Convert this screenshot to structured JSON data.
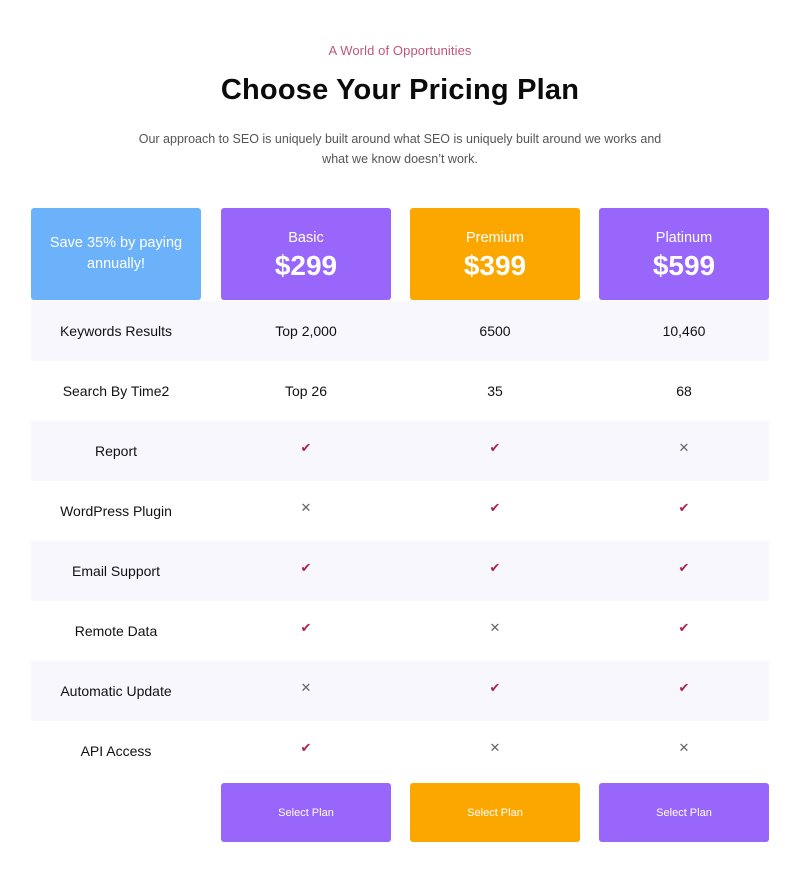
{
  "header": {
    "eyebrow": "A World of Opportunities",
    "title": "Choose Your Pricing Plan",
    "subtitle": "Our approach to SEO is uniquely built around what SEO is uniquely built around we  works and what we know doesn’t work."
  },
  "colors": {
    "save_card": "#6cb2fb",
    "purple": "#9966fb",
    "orange": "#fca700",
    "check": "#b01f4a",
    "cross": "#666666",
    "eyebrow": "#c0567a"
  },
  "promo": {
    "text": "Save 35% by paying annually!"
  },
  "plans": [
    {
      "name": "Basic",
      "price": "$299",
      "color": "#9966fb",
      "button": "Select Plan"
    },
    {
      "name": "Premium",
      "price": "$399",
      "color": "#fca700",
      "button": "Select Plan"
    },
    {
      "name": "Platinum",
      "price": "$599",
      "color": "#9966fb",
      "button": "Select Plan"
    }
  ],
  "features": [
    {
      "label": "Keywords Results",
      "values": [
        "Top 2,000",
        "6500",
        "10,460"
      ]
    },
    {
      "label": "Search By Time2",
      "values": [
        "Top 26",
        "35",
        "68"
      ]
    },
    {
      "label": "Report",
      "values": [
        "check",
        "check",
        "cross"
      ]
    },
    {
      "label": "WordPress Plugin",
      "values": [
        "cross",
        "check",
        "check"
      ]
    },
    {
      "label": "Email Support",
      "values": [
        "check",
        "check",
        "check"
      ]
    },
    {
      "label": "Remote Data",
      "values": [
        "check",
        "cross",
        "check"
      ]
    },
    {
      "label": "Automatic Update",
      "values": [
        "cross",
        "check",
        "check"
      ]
    },
    {
      "label": "API Access",
      "values": [
        "check",
        "cross",
        "cross"
      ]
    }
  ],
  "icons": {
    "check": "✔",
    "cross": "✕"
  }
}
